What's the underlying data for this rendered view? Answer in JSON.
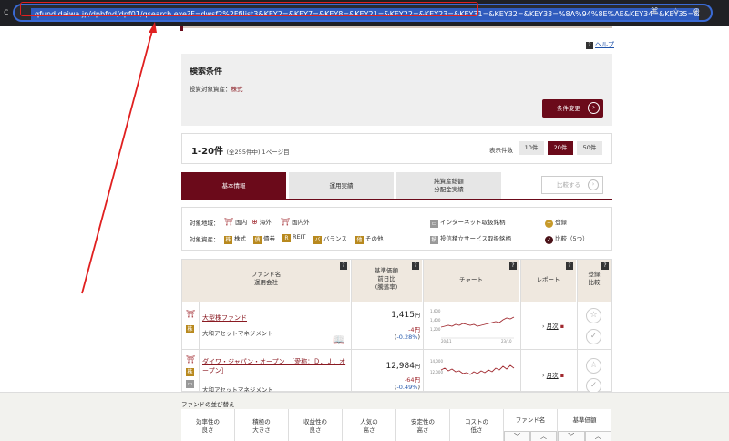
{
  "browser": {
    "url": "qfund.daiwa.jp/dpbfnd/dpf01/qsearch.exe?F=dwsf2%2Ffilist3&KEY2=&KEY7=&KEY8=&KEY21=&KEY22=&KEY23=&KEY31=&KEY32=&KEY33=%8A%94%8E%AE&KEY34=&KEY35=&KEY36=&KEY47=&KEY48=&KEY9",
    "left_icon": "c",
    "right_icons": "⌘ ☆ ⊕"
  },
  "help": {
    "icon": "?",
    "label": "ヘルプ"
  },
  "conditions": {
    "title": "検索条件",
    "asset_label": "投資対象資産：",
    "asset_value": "株式",
    "change_button": "条件変更"
  },
  "results": {
    "range": "1-20件",
    "summary": "(全255件中) 1ページ目",
    "display_label": "表示件数",
    "page_sizes": [
      "10件",
      "20件",
      "50件"
    ]
  },
  "tabs": {
    "basic": "基本情報",
    "performance": "運用実績",
    "assets_line1": "純資産総額",
    "assets_line2": "分配金実績",
    "compare": "比較する"
  },
  "legend": {
    "region_label": "対象地域：",
    "regions": [
      "国内",
      "海外",
      "国内外"
    ],
    "asset_label": "対象資産：",
    "assets": [
      "株式",
      "債券",
      "REIT",
      "バランス",
      "その他"
    ],
    "asset_marks": [
      "株",
      "債",
      "R",
      "バ",
      "他"
    ],
    "internet": "インターネット取扱銘柄",
    "tsumitate": "投信積立サービス取扱銘柄",
    "tsumitate_mark": "積",
    "register": "登録",
    "register_mark": "+",
    "compare": "比較（5つ）",
    "compare_mark": "✓"
  },
  "table": {
    "headers": {
      "fund_line1": "ファンド名",
      "fund_line2": "運用会社",
      "price_line1": "基準価額",
      "price_line2": "前日比",
      "price_line3": "(騰落率)",
      "chart": "チャート",
      "report": "レポート",
      "reg_line1": "登録",
      "reg_line2": "比較",
      "help_mark": "?"
    },
    "rows": [
      {
        "mark": "株",
        "name": "大型株ファンド",
        "company": "大和アセットマネジメント",
        "price": "1,415",
        "unit": "円",
        "change": "-4円",
        "pct": "-0.28%",
        "report": "月次",
        "chart_y_labels": [
          "1,600",
          "1,400",
          "1,200"
        ],
        "chart_x_labels": [
          "20/11",
          "23/10"
        ]
      },
      {
        "mark": "株",
        "name": "ダイワ・ジャパン・オープン　［愛称：Ｄ．Ｊ．オープン］",
        "company": "大和アセットマネジメント",
        "price": "12,984",
        "unit": "円",
        "change": "-64円",
        "pct": "-0.49%",
        "report": "月次",
        "chart_y_labels": [
          "14,000",
          "12,000"
        ],
        "chart_x_labels": []
      }
    ]
  },
  "sort_panel": {
    "title": "ファンドの並び替え",
    "columns": [
      [
        "効率性の",
        "良さ"
      ],
      [
        "積極の",
        "大きさ"
      ],
      [
        "収益性の",
        "良さ"
      ],
      [
        "人気の",
        "高さ"
      ],
      [
        "安定性の",
        "高さ"
      ],
      [
        "コストの",
        "低さ"
      ],
      [
        "ファンド名",
        ""
      ],
      [
        "基準価額",
        ""
      ]
    ],
    "arrow_down": "﹀",
    "arrow_up": "︿"
  },
  "colors": {
    "brand": "#6b0a1a",
    "annotation": "#e02020"
  }
}
